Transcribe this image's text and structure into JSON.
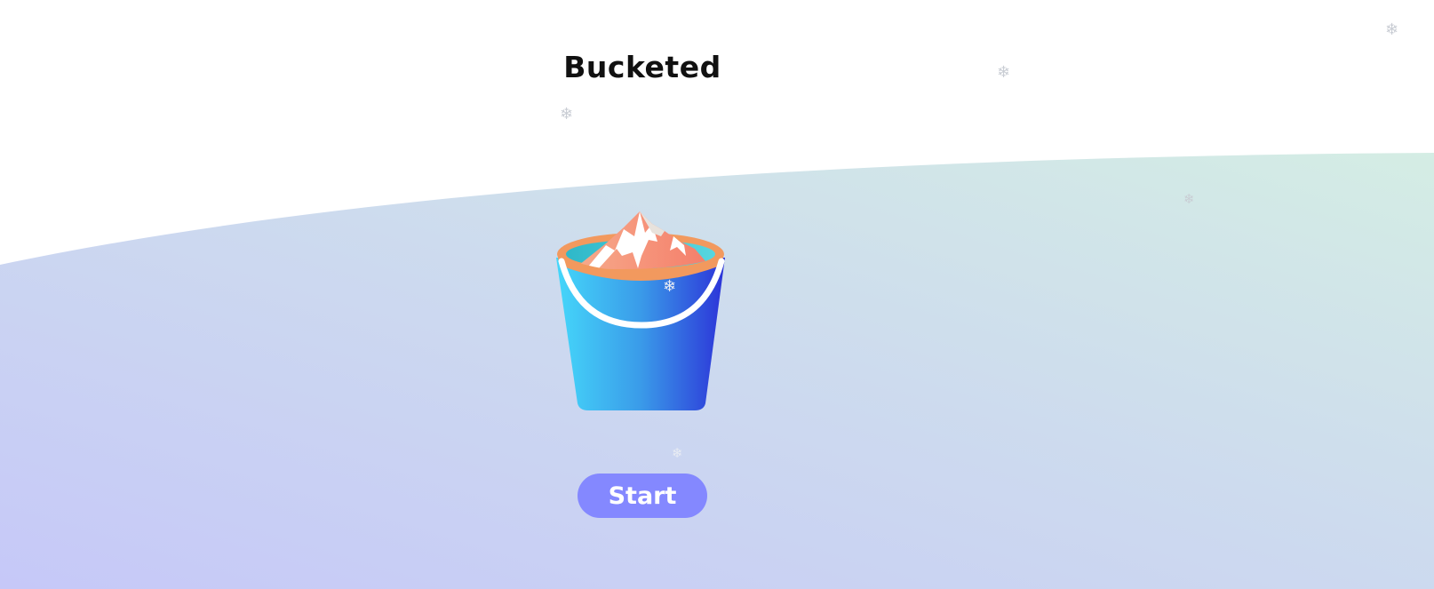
{
  "app": {
    "title": "Bucketed"
  },
  "actions": {
    "start_label": "Start"
  },
  "decorations": {
    "snowflake_glyph": "❄",
    "icons": [
      "bucket-icon",
      "snowflake-icon"
    ]
  },
  "colors": {
    "title": "#111111",
    "button_bg": "#8488ff",
    "button_text": "#ffffff",
    "wave_top": "#d3ebe4",
    "wave_bottom": "#c8ccf7",
    "bucket_left": "#45d4f7",
    "bucket_right": "#2f3ede",
    "bucket_rim": "#f2995e"
  }
}
